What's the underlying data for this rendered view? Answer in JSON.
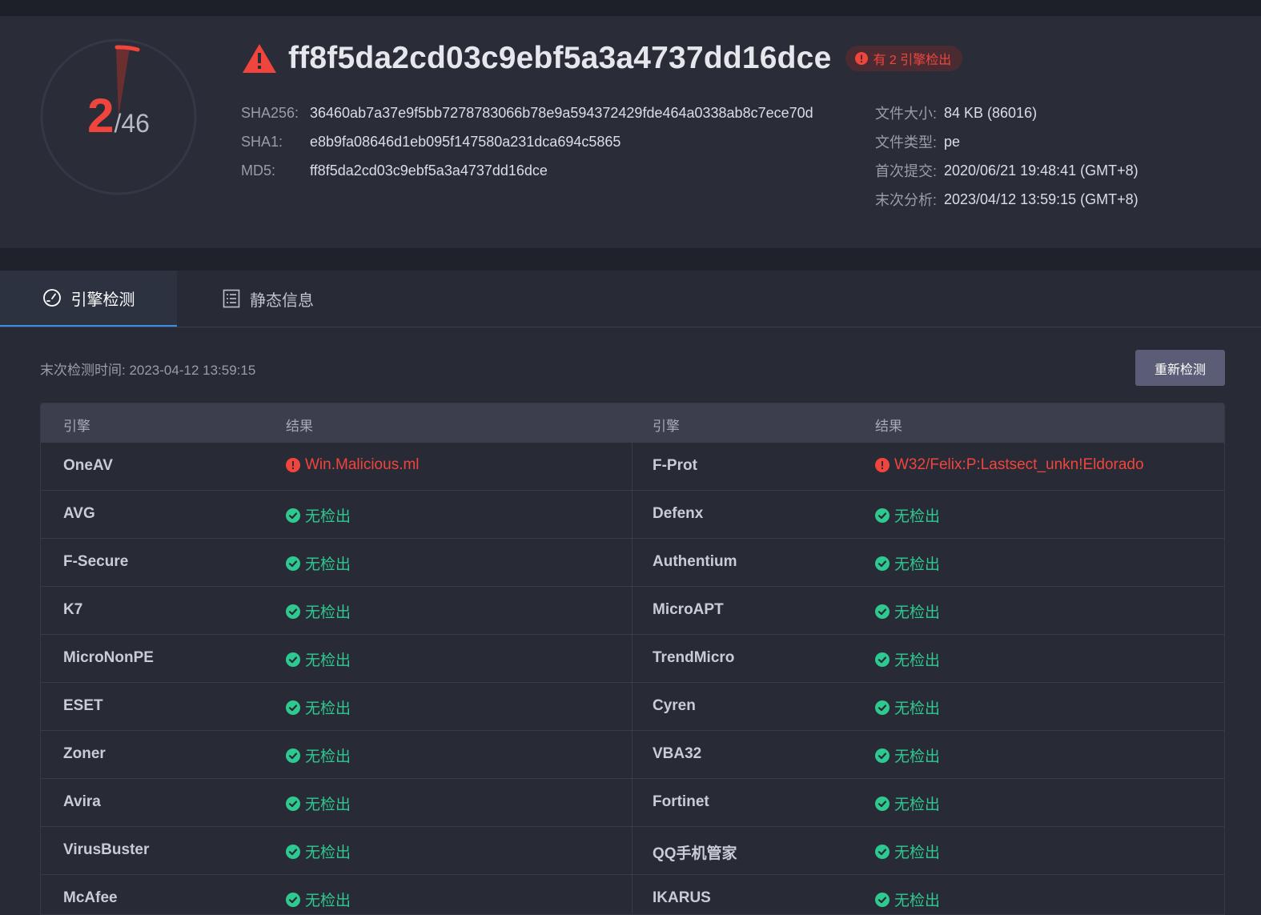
{
  "score": {
    "detected": "2",
    "total": "/46"
  },
  "file": {
    "title": "ff8f5da2cd03c9ebf5a3a4737dd16dce",
    "badge": "有 2 引擎检出",
    "sha256_label": "SHA256:",
    "sha256": "36460ab7a37e9f5bb7278783066b78e9a594372429fde464a0338ab8c7ece70d",
    "sha1_label": "SHA1:",
    "sha1": "e8b9fa08646d1eb095f147580a231dca694c5865",
    "md5_label": "MD5:",
    "md5": "ff8f5da2cd03c9ebf5a3a4737dd16dce",
    "size_label": "文件大小:",
    "size": "84 KB (86016)",
    "type_label": "文件类型:",
    "type": "pe",
    "first_label": "首次提交:",
    "first": "2020/06/21 19:48:41 (GMT+8)",
    "last_label": "末次分析:",
    "last": "2023/04/12 13:59:15 (GMT+8)"
  },
  "tabs": [
    {
      "label": "引擎检测"
    },
    {
      "label": "静态信息"
    }
  ],
  "scan": {
    "last_time": "末次检测时间: 2023-04-12 13:59:15",
    "rescan_label": "重新检测"
  },
  "table": {
    "headers": [
      "引擎",
      "结果",
      "引擎",
      "结果"
    ],
    "rows": [
      [
        {
          "engine": "OneAV",
          "result": "Win.Malicious.ml",
          "status": "bad"
        },
        {
          "engine": "F-Prot",
          "result": "W32/Felix:P:Lastsect_unkn!Eldorado",
          "status": "bad"
        }
      ],
      [
        {
          "engine": "AVG",
          "result": "无检出",
          "status": "ok"
        },
        {
          "engine": "Defenx",
          "result": "无检出",
          "status": "ok"
        }
      ],
      [
        {
          "engine": "F-Secure",
          "result": "无检出",
          "status": "ok"
        },
        {
          "engine": "Authentium",
          "result": "无检出",
          "status": "ok"
        }
      ],
      [
        {
          "engine": "K7",
          "result": "无检出",
          "status": "ok"
        },
        {
          "engine": "MicroAPT",
          "result": "无检出",
          "status": "ok"
        }
      ],
      [
        {
          "engine": "MicroNonPE",
          "result": "无检出",
          "status": "ok"
        },
        {
          "engine": "TrendMicro",
          "result": "无检出",
          "status": "ok"
        }
      ],
      [
        {
          "engine": "ESET",
          "result": "无检出",
          "status": "ok"
        },
        {
          "engine": "Cyren",
          "result": "无检出",
          "status": "ok"
        }
      ],
      [
        {
          "engine": "Zoner",
          "result": "无检出",
          "status": "ok"
        },
        {
          "engine": "VBA32",
          "result": "无检出",
          "status": "ok"
        }
      ],
      [
        {
          "engine": "Avira",
          "result": "无检出",
          "status": "ok"
        },
        {
          "engine": "Fortinet",
          "result": "无检出",
          "status": "ok"
        }
      ],
      [
        {
          "engine": "VirusBuster",
          "result": "无检出",
          "status": "ok"
        },
        {
          "engine": "QQ手机管家",
          "result": "无检出",
          "status": "ok"
        }
      ],
      [
        {
          "engine": "McAfee",
          "result": "无检出",
          "status": "ok"
        },
        {
          "engine": "IKARUS",
          "result": "无检出",
          "status": "ok"
        }
      ]
    ]
  },
  "colors": {
    "danger": "#f0453d",
    "success": "#2ec990",
    "accent": "#3c8ee6",
    "background": "#282a35"
  },
  "icons": {
    "title": "warning-triangle-icon",
    "badge": "exclamation-circle-icon",
    "tab_detect": "gauge-icon",
    "tab_static": "document-list-icon",
    "bad": "exclamation-circle-icon",
    "ok": "check-circle-icon"
  }
}
